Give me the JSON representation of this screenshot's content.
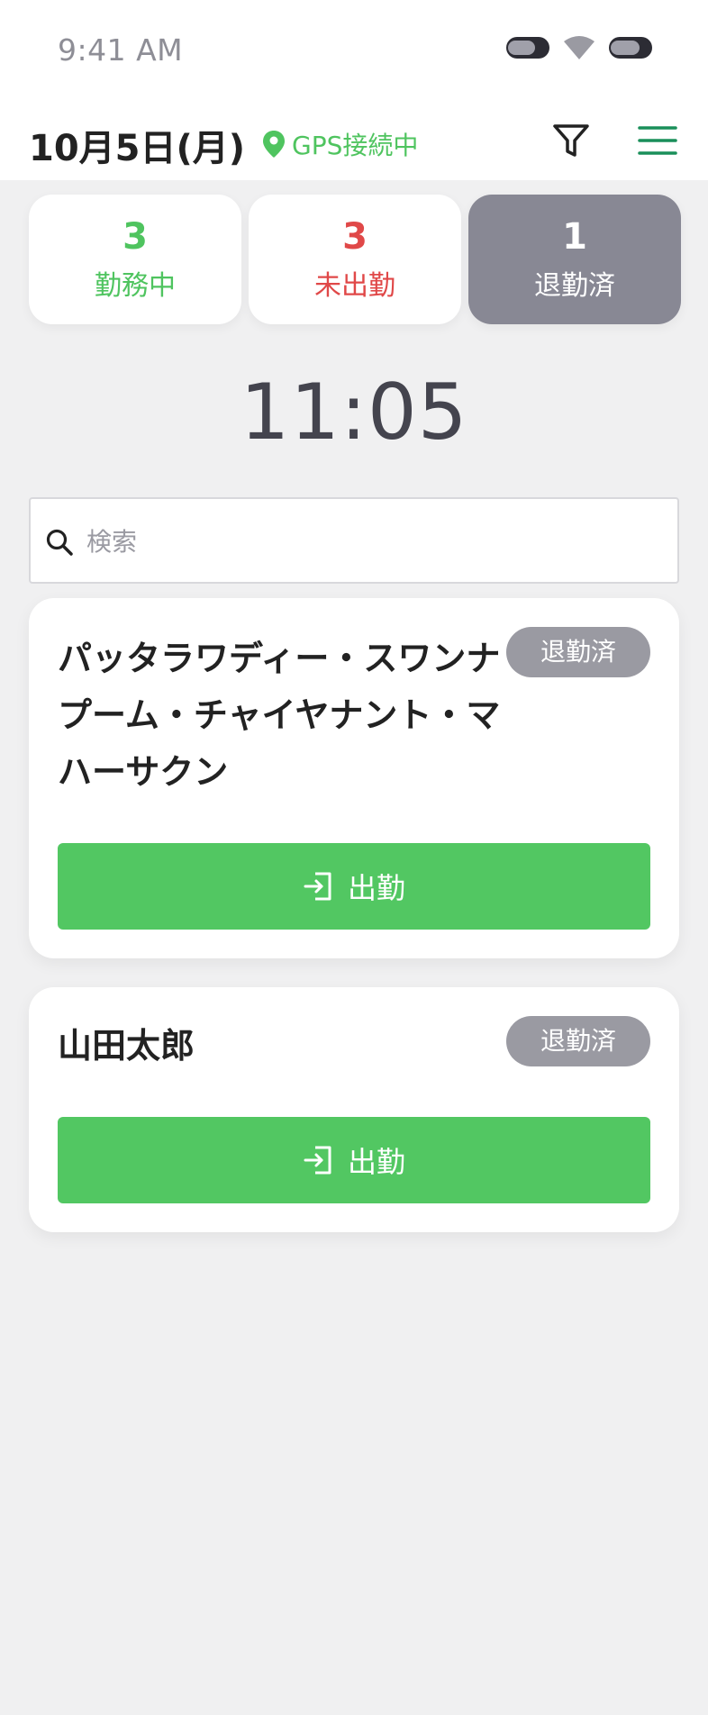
{
  "status_bar": {
    "time": "9:41 AM"
  },
  "header": {
    "date": "10月5日(月)",
    "gps_status": "GPS接続中",
    "accent_color": "#4fc45f",
    "menu_color": "#1a8f5a"
  },
  "summary": {
    "working": {
      "count": "3",
      "label": "勤務中",
      "color": "#4fc45f"
    },
    "absent": {
      "count": "3",
      "label": "未出勤",
      "color": "#e04848"
    },
    "left": {
      "count": "1",
      "label": "退勤済",
      "color": "#888894"
    }
  },
  "clock": "11:05",
  "search": {
    "placeholder": "検索",
    "value": ""
  },
  "employees": [
    {
      "name": "パッタラワディー・スワンナプーム・チャイヤナント・マハーサクン",
      "status": "退勤済",
      "action_label": "出勤"
    },
    {
      "name": "山田太郎",
      "status": "退勤済",
      "action_label": "出勤"
    }
  ],
  "icons": {
    "location": "location-pin-icon",
    "filter": "filter-icon",
    "menu": "hamburger-menu-icon",
    "search": "search-icon",
    "clock_in": "enter-icon"
  }
}
